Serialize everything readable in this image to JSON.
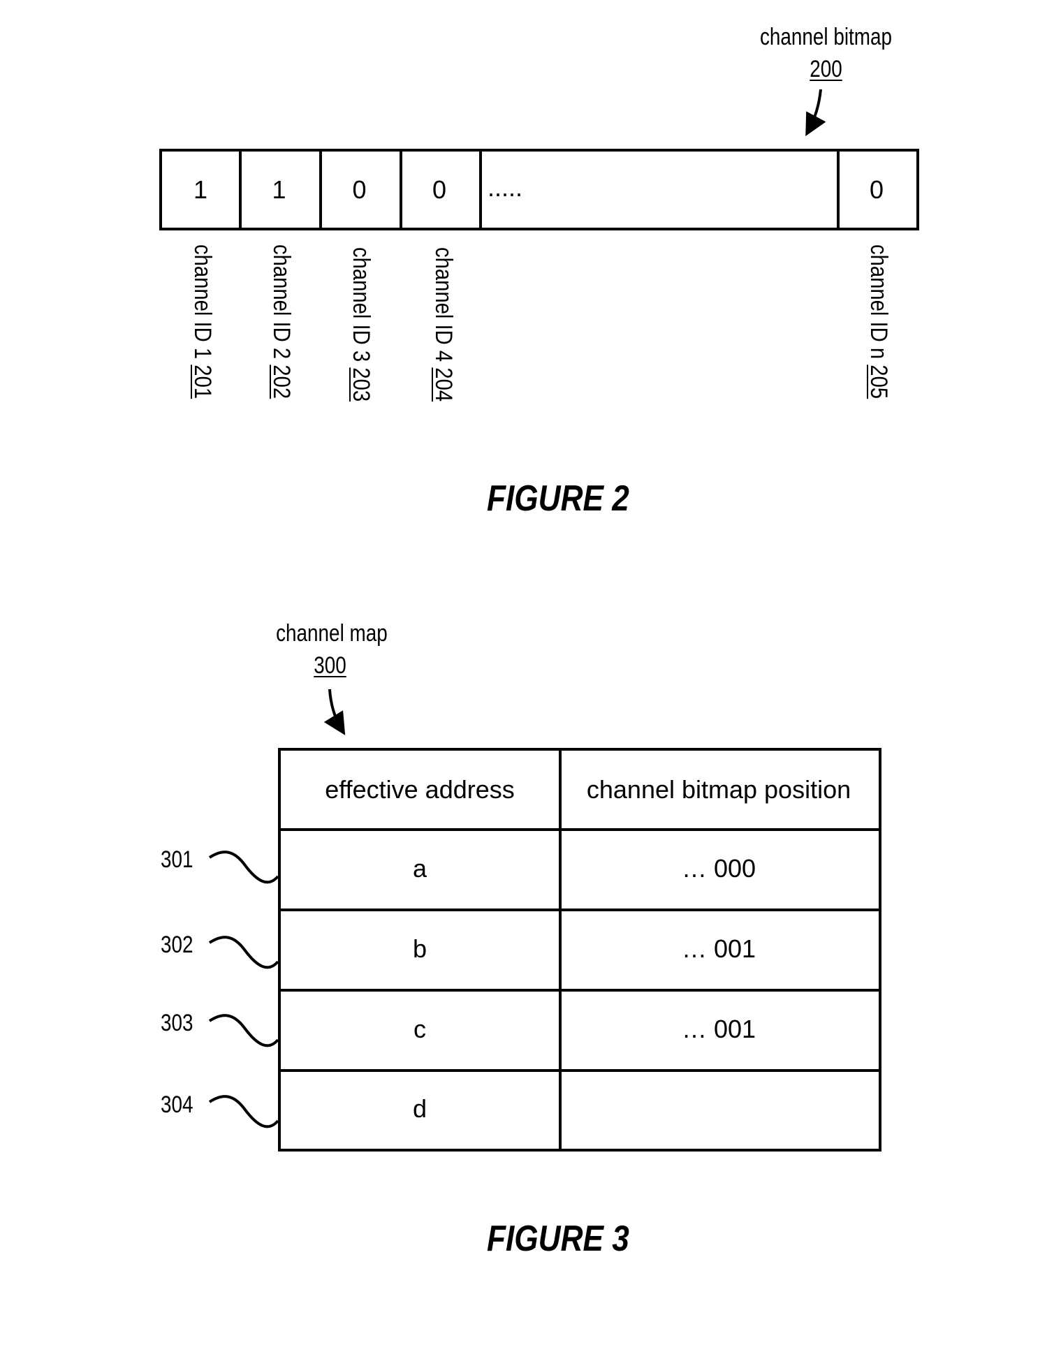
{
  "figure2": {
    "bitmap_label": "channel bitmap",
    "bitmap_ref": "200",
    "cells": [
      "1",
      "1",
      "0",
      "0",
      ".....",
      "0"
    ],
    "channel_labels": [
      {
        "text": "channel ID 1 ",
        "ref": "201"
      },
      {
        "text": "channel ID 2 ",
        "ref": "202"
      },
      {
        "text": "channel ID 3 ",
        "ref": "203"
      },
      {
        "text": "channel ID 4 ",
        "ref": "204"
      },
      {
        "text": "channel ID n ",
        "ref": "205"
      }
    ],
    "caption": "FIGURE 2"
  },
  "figure3": {
    "map_label": "channel map",
    "map_ref": "300",
    "headers": [
      "effective address",
      "channel bitmap position"
    ],
    "rows": [
      {
        "ref": "301",
        "address": "a",
        "position": "… 000"
      },
      {
        "ref": "302",
        "address": "b",
        "position": "… 001"
      },
      {
        "ref": "303",
        "address": "c",
        "position": "… 001"
      },
      {
        "ref": "304",
        "address": "d",
        "position": ""
      }
    ],
    "caption": "FIGURE 3"
  }
}
